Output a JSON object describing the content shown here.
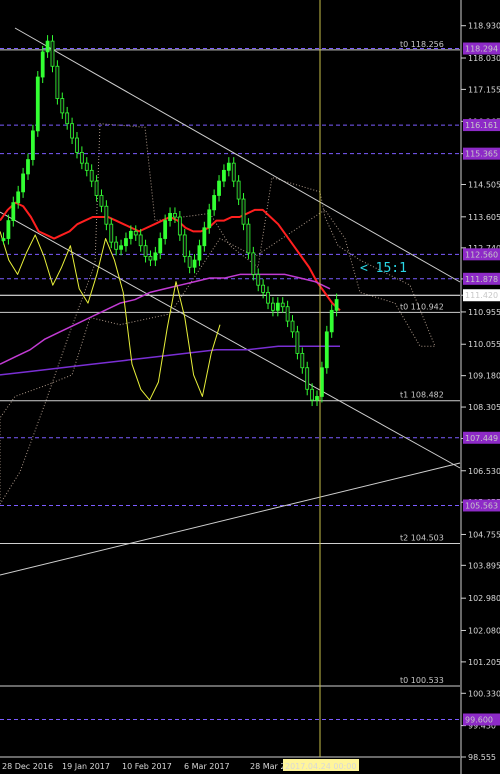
{
  "colors": {
    "background": "#000000",
    "axis_text": "#d8d8d8",
    "grid_dash": "#7b5cff",
    "price_up": "#33ff33",
    "price_down": "#0f0f0f",
    "ma_red": "#ff1f1f",
    "ma_magenta": "#c23bd3",
    "ma_purple": "#7a2fd4",
    "yellow_line": "#e8f03a",
    "cloud": "#e6cbb7",
    "label_box": "#8d2ac7",
    "ref_line": "#cfcfcf",
    "current_line": "#ffffff",
    "vertical_marker": "#c9c04a",
    "date_label_bg": "#fff59a"
  },
  "chart_data": {
    "type": "line",
    "title": "",
    "xlabel": "",
    "ylabel": "",
    "ylim": [
      98.555,
      119.2
    ],
    "x_ticks": [
      "28 Dec 2016",
      "19 Jan 2017",
      "10 Feb 2017",
      "6 Mar 2017",
      "28 Mar 2",
      "2017.04.24 00:00"
    ],
    "y_ticks": [
      "118.930",
      "118.030",
      "117.155",
      "116.265",
      "115.365",
      "114.505",
      "113.605",
      "112.740",
      "111.875",
      "111.420",
      "110.955",
      "110.055",
      "109.180",
      "108.305",
      "107.430",
      "106.530",
      "105.655",
      "104.755",
      "103.895",
      "102.980",
      "102.080",
      "101.205",
      "100.330",
      "99.430",
      "98.555"
    ],
    "series": [
      {
        "values": [
          113.0,
          113.5,
          114.0,
          114.3,
          114.8,
          115.2,
          116.0,
          117.5,
          118.2,
          118.5,
          117.8,
          116.9,
          116.5,
          116.2,
          115.8,
          115.4,
          115.1,
          114.9,
          114.6,
          114.2,
          113.9,
          113.4,
          112.9,
          112.7,
          112.8,
          113.0,
          113.2,
          113.1,
          112.8,
          112.5,
          112.4,
          112.6,
          113.0,
          113.5,
          113.7,
          113.6,
          113.1,
          112.5,
          112.2,
          112.4,
          112.8,
          113.3,
          113.8,
          114.2,
          114.6,
          114.9,
          115.1,
          114.6,
          114.1,
          113.4,
          112.6,
          112.0,
          111.7,
          111.5,
          111.2,
          111.0,
          111.2,
          111.1,
          110.7,
          110.4,
          109.8,
          109.4,
          108.8,
          108.5,
          108.6,
          109.4,
          110.4,
          111.0,
          111.3
        ]
      },
      {
        "values": [
          113.5,
          113.8,
          114.0,
          113.9,
          113.6,
          113.2,
          113.1,
          113.0,
          113.1,
          113.2,
          113.4,
          113.5,
          113.6,
          113.6,
          113.6,
          113.5,
          113.4,
          113.3,
          113.2,
          113.3,
          113.4,
          113.5,
          113.6,
          113.5,
          113.3,
          113.2,
          113.2,
          113.3,
          113.5,
          113.5,
          113.6,
          113.6,
          113.7,
          113.8,
          113.8,
          113.6,
          113.4,
          113.1,
          112.8,
          112.5,
          112.2,
          111.8,
          111.5,
          111.2,
          111.0
        ]
      },
      {
        "values": [
          109.5,
          109.7,
          109.9,
          110.2,
          110.4,
          110.6,
          110.8,
          111.0,
          111.2,
          111.3,
          111.5,
          111.6,
          111.7,
          111.8,
          111.9,
          111.9,
          112.0,
          112.0,
          112.0,
          112.0,
          111.9,
          111.8,
          111.6
        ]
      },
      {
        "values": [
          109.2,
          109.3,
          109.4,
          109.5,
          109.6,
          109.7,
          109.8,
          109.9,
          109.9,
          110.0,
          110.0,
          110.0
        ]
      },
      {
        "values": [
          113.2,
          112.4,
          112.0,
          112.6,
          113.1,
          112.5,
          111.7,
          112.2,
          112.8,
          111.6,
          111.2,
          112.0,
          113.0,
          112.4,
          111.5,
          109.5,
          108.8,
          108.5,
          109.0,
          110.5,
          111.8,
          110.8,
          109.2,
          108.6,
          109.8,
          110.6
        ]
      }
    ],
    "levels": [
      {
        "label": "t0 118.256",
        "value": 118.256,
        "kind": "plain"
      },
      {
        "label": "118.294",
        "value": 118.294,
        "kind": "box"
      },
      {
        "label": "116.161",
        "value": 116.161,
        "kind": "box"
      },
      {
        "label": "115.365",
        "value": 115.365,
        "kind": "box"
      },
      {
        "label": "112.560",
        "value": 112.56,
        "kind": "box"
      },
      {
        "label": "111.878",
        "value": 111.878,
        "kind": "box"
      },
      {
        "label": "111.420",
        "value": 111.42,
        "kind": "price"
      },
      {
        "label": "t0 110.942",
        "value": 110.942,
        "kind": "plain"
      },
      {
        "label": "t1 108.482",
        "value": 108.482,
        "kind": "plain"
      },
      {
        "label": "107.449",
        "value": 107.449,
        "kind": "box"
      },
      {
        "label": "105.563",
        "value": 105.563,
        "kind": "box"
      },
      {
        "label": "t2 104.503",
        "value": 104.503,
        "kind": "plain"
      },
      {
        "label": "t0 100.533",
        "value": 100.533,
        "kind": "plain"
      },
      {
        "label": "99.600",
        "value": 99.6,
        "kind": "box"
      }
    ],
    "annotations": [
      {
        "text": "< 15:1"
      }
    ]
  }
}
